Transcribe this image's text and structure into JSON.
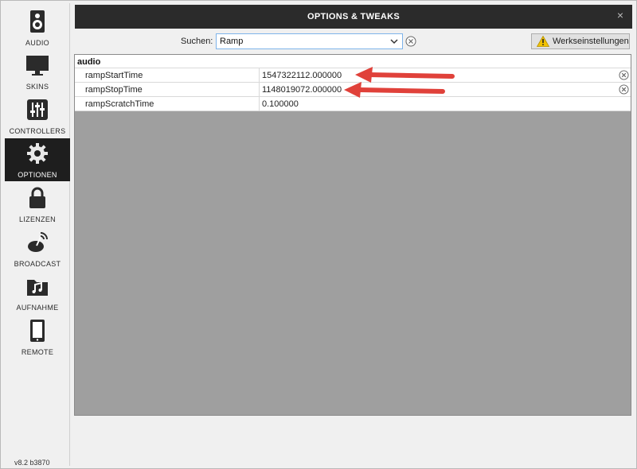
{
  "sidebar": {
    "items": [
      {
        "label": "AUDIO",
        "icon": "speaker-icon"
      },
      {
        "label": "SKINS",
        "icon": "monitor-icon"
      },
      {
        "label": "CONTROLLERS",
        "icon": "sliders-icon"
      },
      {
        "label": "OPTIONEN",
        "icon": "gear-icon",
        "active": true
      },
      {
        "label": "LIZENZEN",
        "icon": "lock-icon"
      },
      {
        "label": "BROADCAST",
        "icon": "broadcast-icon"
      },
      {
        "label": "AUFNAHME",
        "icon": "music-folder-icon"
      },
      {
        "label": "REMOTE",
        "icon": "tablet-icon"
      }
    ],
    "version": "v8.2 b3870"
  },
  "window": {
    "title": "OPTIONS & TWEAKS",
    "close_label": "×"
  },
  "search": {
    "label": "Suchen:",
    "value": "Ramp"
  },
  "factory_button": {
    "label": "Werkseinstellungen"
  },
  "options": {
    "group": "audio",
    "rows": [
      {
        "name": "rampStartTime",
        "value": "1547322112.000000",
        "modified": true
      },
      {
        "name": "rampStopTime",
        "value": "1148019072.000000",
        "modified": true
      },
      {
        "name": "rampScratchTime",
        "value": "0.100000",
        "modified": false
      }
    ]
  },
  "colors": {
    "titlebar": "#2b2b2b",
    "grid_background": "#9f9f9f",
    "active_sidebar": "#1e1e1e",
    "annotation_arrow": "#e0413a"
  }
}
